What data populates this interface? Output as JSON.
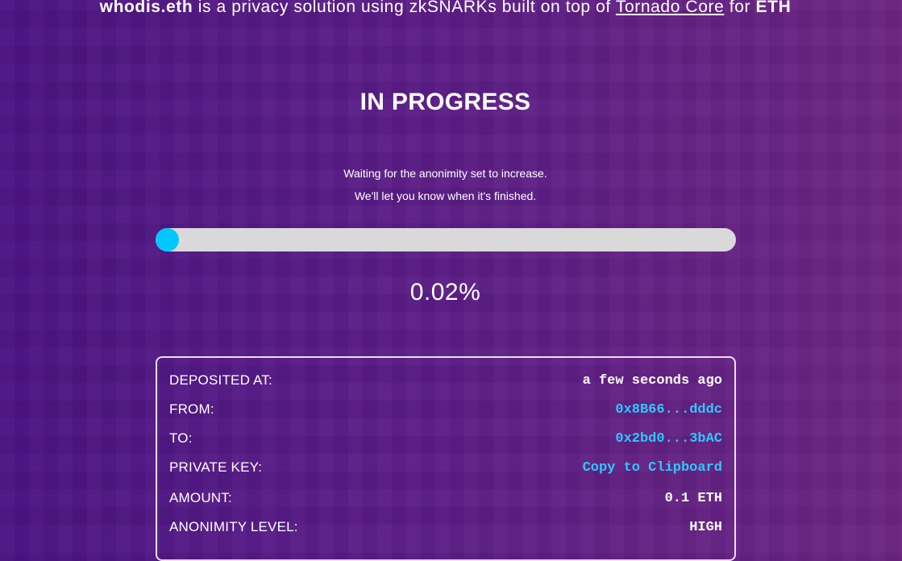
{
  "header": {
    "brand": "whodis.eth",
    "text_middle": " is a privacy solution using zkSNARKs built on top of ",
    "link_text": "Tornado Core",
    "text_for": " for ",
    "currency": "ETH"
  },
  "status": {
    "title": "IN PROGRESS",
    "line1": "Waiting for the anonimity set to increase.",
    "line2": "We'll let you know when it's finished.",
    "progress_percent_label": "0.02%",
    "progress_fraction": 0.0002
  },
  "details": {
    "rows": [
      {
        "label": "DEPOSITED AT:",
        "value": "a few seconds ago"
      },
      {
        "label": "FROM:",
        "value": "0x8B66...dddc"
      },
      {
        "label": "TO:",
        "value": "0x2bd0...3bAC"
      },
      {
        "label": "PRIVATE KEY:",
        "value": "Copy to Clipboard"
      },
      {
        "label": "AMOUNT:",
        "value": "0.1 ETH"
      },
      {
        "label": "ANONIMITY LEVEL:",
        "value": "HIGH"
      }
    ]
  },
  "colors": {
    "accent": "#00c8ff",
    "link": "#2ec8ff",
    "track": "#d9d9d9",
    "background_left": "#4a1282",
    "background_right": "#6b2580"
  }
}
